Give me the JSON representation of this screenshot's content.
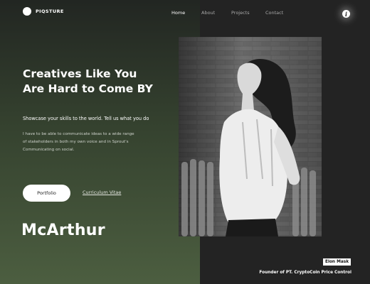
{
  "brand": {
    "logo_text": "PIQSTURE"
  },
  "nav": {
    "items": [
      {
        "label": "Home"
      },
      {
        "label": "About"
      },
      {
        "label": "Projects"
      },
      {
        "label": "Contact"
      }
    ],
    "active": "Home"
  },
  "hero": {
    "title_line1": "Creatives Like You",
    "title_line2": "Are Hard to Come BY",
    "subtitle": "Showcase your skills to the world. Tell us what you do",
    "description_line1": "I have to be able to communicate ideas to a wide range",
    "description_line2": "of stakeholders in both my own voice and in Sprout's",
    "description_line3": "Communicating on social.",
    "primary_button": "Portfolio",
    "secondary_link": "Curriculum Vitae",
    "name": "McArthur"
  },
  "photo_caption": {
    "name": "Elon Mask",
    "role": "Founder of PT. CryptoCoin Price Control"
  },
  "icons": {
    "info": "info-icon",
    "logo": "logo-circle-icon"
  },
  "colors": {
    "accent_green": "#4c5e40",
    "dark": "#232323",
    "white": "#ffffff"
  }
}
